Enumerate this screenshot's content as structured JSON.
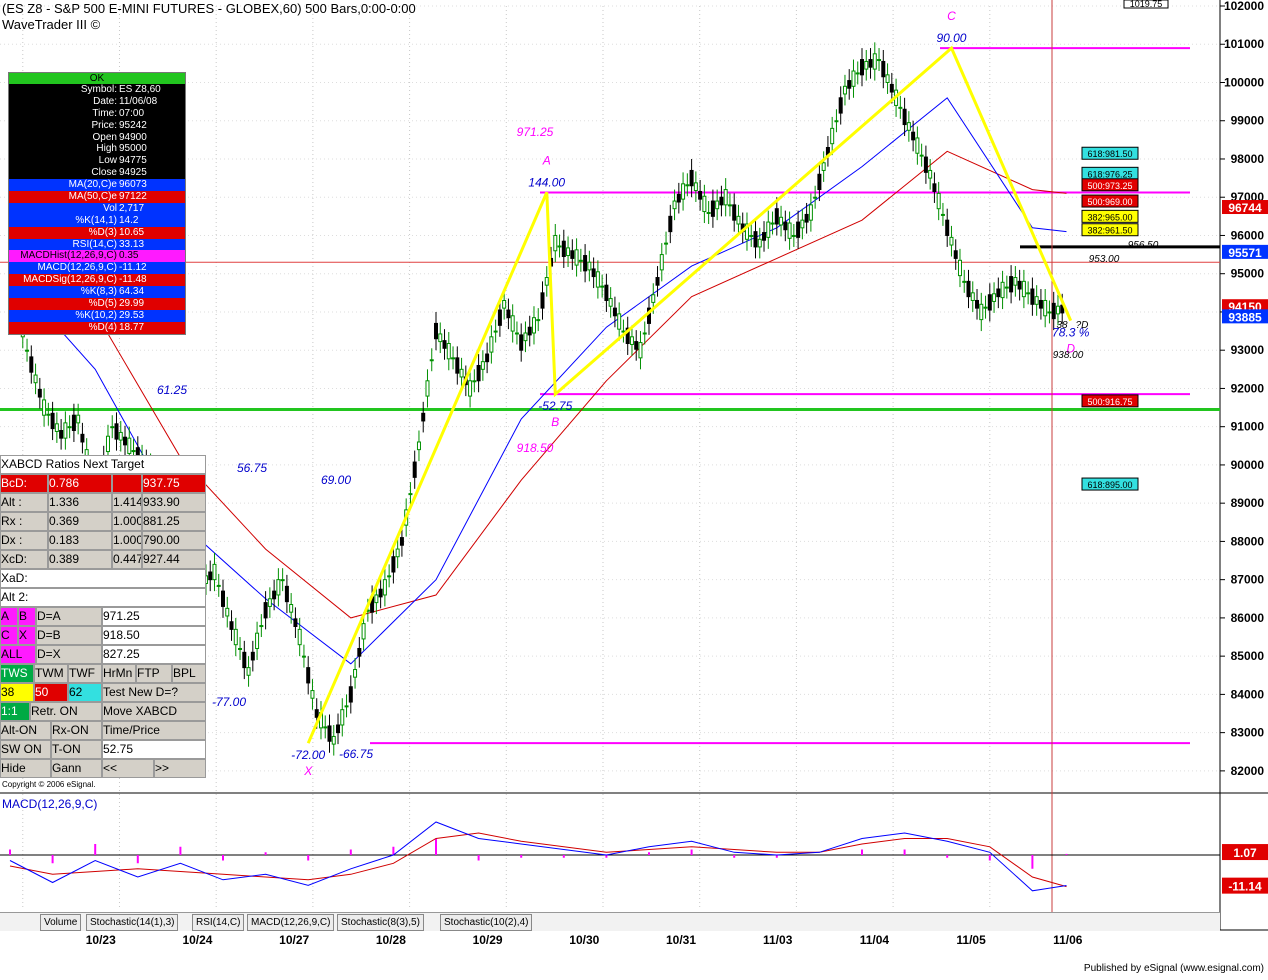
{
  "window": {
    "title": "(ES Z8 - S&P 500 E-MINI FUTURES - GLOBEX,60) 500 Bars,0:00-0:00",
    "subtitle": "WaveTrader III ©",
    "copyright": "Copyright © 2006 eSignal.",
    "published": "Published by eSignal (www.esignal.com)",
    "top_right_box": "1019.75"
  },
  "colors": {
    "price_up": "#009000",
    "price_down": "#000000",
    "ma20": "#0000ff",
    "ma50": "#d00000",
    "pattern_line": "#ffff00",
    "level_line": "#ff00ff",
    "green_line": "#22c51f",
    "macd": "#0000ff",
    "signal": "#d00000",
    "hist": "#ff00ff"
  },
  "info_box": {
    "status": "OK",
    "rows": [
      {
        "k": "Symbol:",
        "v": "ES Z8,60",
        "c": "plain"
      },
      {
        "k": "Date:",
        "v": "11/06/08",
        "c": "plain"
      },
      {
        "k": "Time:",
        "v": "07:00",
        "c": "plain"
      },
      {
        "k": "Price:",
        "v": "95242",
        "c": "plain"
      },
      {
        "k": "Open",
        "v": "94900",
        "c": "plain"
      },
      {
        "k": "High",
        "v": "95000",
        "c": "plain"
      },
      {
        "k": "Low",
        "v": "94775",
        "c": "plain"
      },
      {
        "k": "Close",
        "v": "94925",
        "c": "plain"
      },
      {
        "k": "MA(20,C)e",
        "v": "96073",
        "c": "blue"
      },
      {
        "k": "MA(50,C)e",
        "v": "97122",
        "c": "red"
      },
      {
        "k": "Vol",
        "v": "2,717",
        "c": "blue"
      },
      {
        "k": "%K(14,1)",
        "v": "14.2",
        "c": "blue"
      },
      {
        "k": "%D(3)",
        "v": "10.65",
        "c": "red"
      },
      {
        "k": "RSI(14,C)",
        "v": "33.13",
        "c": "blue"
      },
      {
        "k": "MACDHist(12,26,9,C)",
        "v": "0.35",
        "c": "mag"
      },
      {
        "k": "MACD(12,26,9,C)",
        "v": "-11.12",
        "c": "blue"
      },
      {
        "k": "MACDSig(12,26,9,C)",
        "v": "-11.48",
        "c": "red"
      },
      {
        "k": "%K(8,3)",
        "v": "64.34",
        "c": "blue"
      },
      {
        "k": "%D(5)",
        "v": "29.99",
        "c": "red"
      },
      {
        "k": "%K(10,2)",
        "v": "29.53",
        "c": "blue"
      },
      {
        "k": "%D(4)",
        "v": "18.77",
        "c": "red"
      }
    ]
  },
  "xabcd_panel": {
    "title": "XABCD Ratios",
    "next_target": "Next Target",
    "rows": [
      {
        "label": "BcD:",
        "a": "0.786",
        "b": "",
        "c": "937.75"
      },
      {
        "label": "Alt  :",
        "a": "1.336",
        "b": "1.414",
        "c": "933.90"
      },
      {
        "label": "Rx  :",
        "a": "0.369",
        "b": "1.000",
        "c": "881.25"
      },
      {
        "label": "Dx  :",
        "a": "0.183",
        "b": "1.000",
        "c": "790.00"
      },
      {
        "label": "XcD:",
        "a": "0.389",
        "b": "0.447",
        "c": "927.44"
      }
    ],
    "xad": "XaD:",
    "alt2": "Alt 2:",
    "d_rows": [
      {
        "l1": "A",
        "l2": "B",
        "eq": "D=A",
        "val": "971.25"
      },
      {
        "l1": "C",
        "l2": "X",
        "eq": "D=B",
        "val": "918.50"
      },
      {
        "l1": "ALL",
        "l2": "",
        "eq": "D=X",
        "val": "827.25"
      }
    ],
    "buttons_row1": [
      "TWS",
      "TWM",
      "TWF",
      "HrMn",
      "FTP",
      "BPL"
    ],
    "buttons_row2": [
      "38",
      "50",
      "62",
      "Test New D=?"
    ],
    "buttons_row3": [
      "1:1",
      "Retr. ON",
      "Move XABCD"
    ],
    "buttons_row4": [
      "Alt-ON",
      "Rx-ON",
      "Time/Price"
    ],
    "buttons_row5": [
      "SW ON",
      "T-ON",
      "52.75"
    ],
    "buttons_row6": [
      "Hide",
      "Gann",
      "<<",
      ">>"
    ]
  },
  "chart_data": {
    "type": "line",
    "title": "(ES Z8 - S&P 500 E-MINI FUTURES - GLOBEX,60) 500 Bars,0:00-0:00",
    "ylim": [
      815,
      1020
    ],
    "y_ticks": [
      "102000",
      "101000",
      "100000",
      "99000",
      "98000",
      "97000",
      "96000",
      "95000",
      "94000",
      "93000",
      "92000",
      "91000",
      "90000",
      "89000",
      "88000",
      "87000",
      "86000",
      "85000",
      "84000",
      "83000",
      "82000"
    ],
    "x_ticks": [
      "10/23",
      "10/24",
      "10/27",
      "10/28",
      "10/29",
      "10/30",
      "10/31",
      "11/03",
      "11/04",
      "11/05",
      "11/06"
    ],
    "series": [
      {
        "name": "",
        "x": [
          0,
          4,
          8,
          12,
          16,
          20,
          24,
          28,
          32,
          36,
          40,
          44,
          48,
          52,
          56,
          60,
          64,
          68,
          72,
          76,
          80,
          84,
          88,
          92,
          96,
          100,
          104,
          108,
          112,
          116,
          120,
          124,
          128,
          132,
          136,
          140,
          144,
          148,
          152,
          156,
          160,
          164,
          168,
          172,
          176,
          180,
          184,
          188,
          192,
          196,
          200,
          204,
          208,
          212,
          216,
          220,
          224,
          228,
          232,
          236,
          240,
          244,
          248
        ],
        "y": [
          952,
          930,
          915,
          908,
          912,
          892,
          910,
          905,
          900,
          892,
          880,
          868,
          872,
          858,
          846,
          862,
          870,
          855,
          835,
          828,
          840,
          862,
          868,
          880,
          905,
          935,
          928,
          920,
          928,
          942,
          932,
          938,
          958,
          955,
          952,
          945,
          935,
          930,
          948,
          968,
          975,
          966,
          970,
          962,
          958,
          965,
          960,
          966,
          982,
          998,
          1004,
          1006,
          996,
          986,
          976,
          962,
          948,
          940,
          945,
          948,
          944,
          940,
          941
        ]
      },
      {
        "name": "MA(20,C)e",
        "x": [
          0,
          20,
          40,
          60,
          80,
          100,
          120,
          140,
          160,
          180,
          200,
          220,
          240,
          248
        ],
        "y": [
          950,
          925,
          885,
          865,
          848,
          870,
          912,
          936,
          952,
          962,
          978,
          996,
          962,
          961
        ]
      },
      {
        "name": "MA(50,C)e",
        "x": [
          0,
          20,
          40,
          60,
          80,
          100,
          120,
          140,
          160,
          180,
          200,
          220,
          240,
          248
        ],
        "y": [
          958,
          940,
          902,
          878,
          860,
          866,
          896,
          922,
          944,
          954,
          964,
          982,
          972,
          971
        ]
      }
    ],
    "pattern_points": [
      {
        "label": "X",
        "x": 70,
        "y": 827.25,
        "text": "-72.00"
      },
      {
        "label": "A",
        "x": 126,
        "y": 971.25,
        "text": "144.00"
      },
      {
        "label": "B",
        "x": 128,
        "y": 918.5,
        "text": "-52.75"
      },
      {
        "label": "C",
        "x": 221,
        "y": 1009,
        "text": "90.00"
      },
      {
        "label": "D",
        "x": 249,
        "y": 937.75,
        "text": "78.3 %"
      }
    ],
    "annotations": [
      "971.25",
      "918.50",
      "61.25",
      "56.75",
      "69.00",
      "-77.00",
      "-66.75",
      "938.00",
      "953.00",
      "956.50",
      "?D",
      "38"
    ],
    "levels": [
      {
        "y": 1009,
        "label": ""
      },
      {
        "y": 971.25,
        "label": ""
      },
      {
        "y": 918.5,
        "label": ""
      },
      {
        "y": 827.25,
        "label": ""
      }
    ],
    "right_labels": [
      {
        "text": "618:981.50",
        "y": 981.5,
        "bg": "#33e0e0"
      },
      {
        "text": "618:976.25",
        "y": 976.25,
        "bg": "#33e0e0"
      },
      {
        "text": "500:973.25",
        "y": 973.25,
        "bg": "#e00000"
      },
      {
        "text": "500:969.00",
        "y": 969,
        "bg": "#e00000"
      },
      {
        "text": "382:965.00",
        "y": 965,
        "bg": "#ffff00"
      },
      {
        "text": "382:961.50",
        "y": 961.5,
        "bg": "#ffff00"
      },
      {
        "text": "500:916.75",
        "y": 916.75,
        "bg": "#e00000"
      },
      {
        "text": "618:895.00",
        "y": 895,
        "bg": "#33e0e0"
      }
    ],
    "axis_value_tags": [
      {
        "text": "96744",
        "y": 967.44,
        "bg": "#e00000"
      },
      {
        "text": "95571",
        "y": 955.71,
        "bg": "#0033ff"
      },
      {
        "text": "94150",
        "y": 941.5,
        "bg": "#e00000"
      },
      {
        "text": "93885",
        "y": 938.85,
        "bg": "#0033ff"
      }
    ],
    "macd": {
      "title": "MACD(12,26,9,C)",
      "macd_tag": "1.07",
      "signal_tag": "-11.14",
      "ylim": [
        -20,
        20
      ],
      "x": [
        0,
        10,
        20,
        30,
        40,
        50,
        60,
        70,
        80,
        90,
        100,
        110,
        120,
        130,
        140,
        150,
        160,
        170,
        180,
        190,
        200,
        210,
        220,
        230,
        240,
        248
      ],
      "macd": [
        -2,
        -10,
        -2,
        -8,
        -3,
        -9,
        -7,
        -11,
        -5,
        0,
        12,
        6,
        4,
        2,
        0,
        3,
        5,
        1,
        0,
        1,
        6,
        8,
        5,
        1,
        -13,
        -11.1
      ],
      "signal": [
        -4,
        -7,
        -6,
        -5,
        -6,
        -7,
        -8,
        -9,
        -7,
        -3,
        6,
        8,
        5,
        3,
        1,
        2,
        3,
        2,
        1,
        1,
        4,
        6,
        6,
        3,
        -8,
        -11.5
      ]
    }
  },
  "tabs": [
    "Volume",
    "Stochastic(14(1),3)",
    "RSI(14,C)",
    "MACD(12,26,9,C)",
    "Stochastic(8(3),5)",
    "Stochastic(10(2),4)"
  ]
}
